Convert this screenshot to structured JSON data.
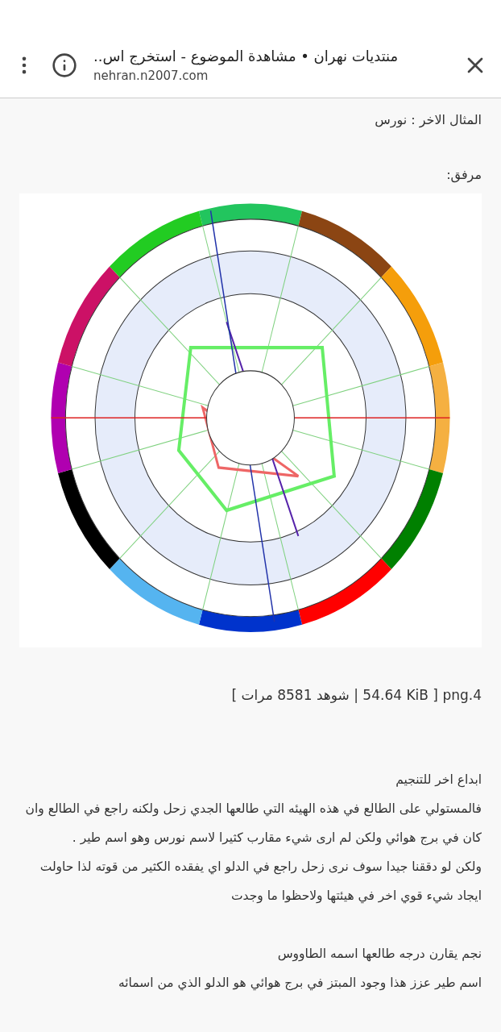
{
  "browser_bar": {
    "title": "منتديات نهران • مشاهدة الموضوع - استخرج اس..",
    "url": "nehran.n2007.com"
  },
  "post": {
    "intro": "المثال الاخر : نورس",
    "attachment_label": "مرفق:",
    "attachment_info": "4.png [ 54.64 KiB | شوهد 8581 مرات ]",
    "paragraphs": [
      {
        "lines": [
          "ابداع اخر للتنجيم",
          "فالمستولي على الطالع في هذه الهيئه التي طالعها الجدي زحل ولكنه راجع في الطالع وان كان في برج هوائي ولكن لم ارى شيء مقارب كثيرا لاسم نورس وهو اسم طير .",
          "ولكن لو دققنا جيدا سوف نرى زحل راجع في الدلو اي يفقده الكثير من قوته لذا حاولت ايجاد شيء قوي اخر في هيئتها ولاحظوا ما وجدت"
        ]
      },
      {
        "lines": [
          "نجم يقارن درجه طالعها اسمه الطاووس",
          "اسم طير عزز هذا وجود المبتز في برج هوائي هو الدلو الذي من اسمائه"
        ]
      }
    ]
  }
}
